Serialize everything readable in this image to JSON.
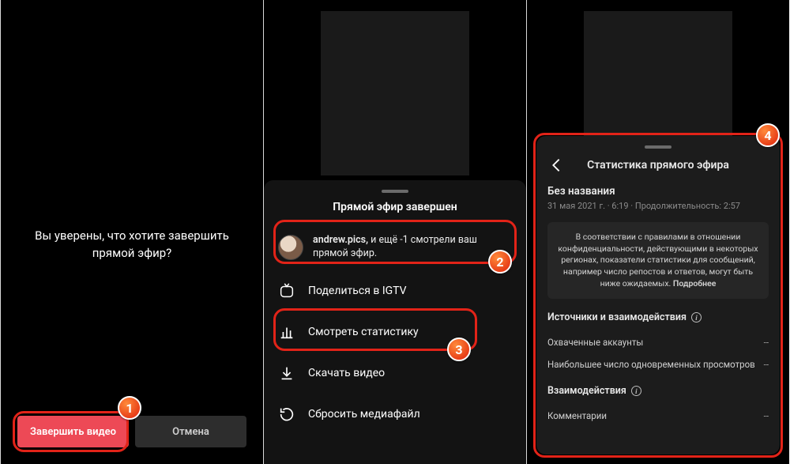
{
  "panel1": {
    "confirm_text": "Вы уверены, что хотите завершить прямой эфир?",
    "end_btn": "Завершить видео",
    "cancel_btn": "Отмена"
  },
  "panel2": {
    "sheet_title": "Прямой эфир завершен",
    "viewer_user": "andrew.pics,",
    "viewer_rest": " и ещё -1 смотрели ваш прямой эфир.",
    "opt_igtv": "Поделиться в IGTV",
    "opt_stats": "Смотреть статистику",
    "opt_download": "Скачать видео",
    "opt_discard": "Сбросить медиафайл"
  },
  "panel3": {
    "title": "Статистика прямого эфира",
    "name": "Без названия",
    "meta": "31 мая 2021 г. · 6:19 · Продолжительность: 2:57",
    "notice": "В соответствии с правилами в отношении конфиденциальности, действующими в некоторых регионах, показатели статистики для сообщений, например число репостов и ответов, могут быть ниже ожидаемых. ",
    "notice_more": "Подробнее",
    "section_sources": "Источники и взаимодействия",
    "row_accounts": "Охваченные аккаунты",
    "row_accounts_val": "--",
    "row_peak": "Наибольшее число одновременных просмотров",
    "row_peak_val": "--",
    "section_inter": "Взаимодействия",
    "row_comments": "Комментарии",
    "row_comments_val": "--"
  },
  "badges": {
    "b1": "1",
    "b2": "2",
    "b3": "3",
    "b4": "4"
  }
}
